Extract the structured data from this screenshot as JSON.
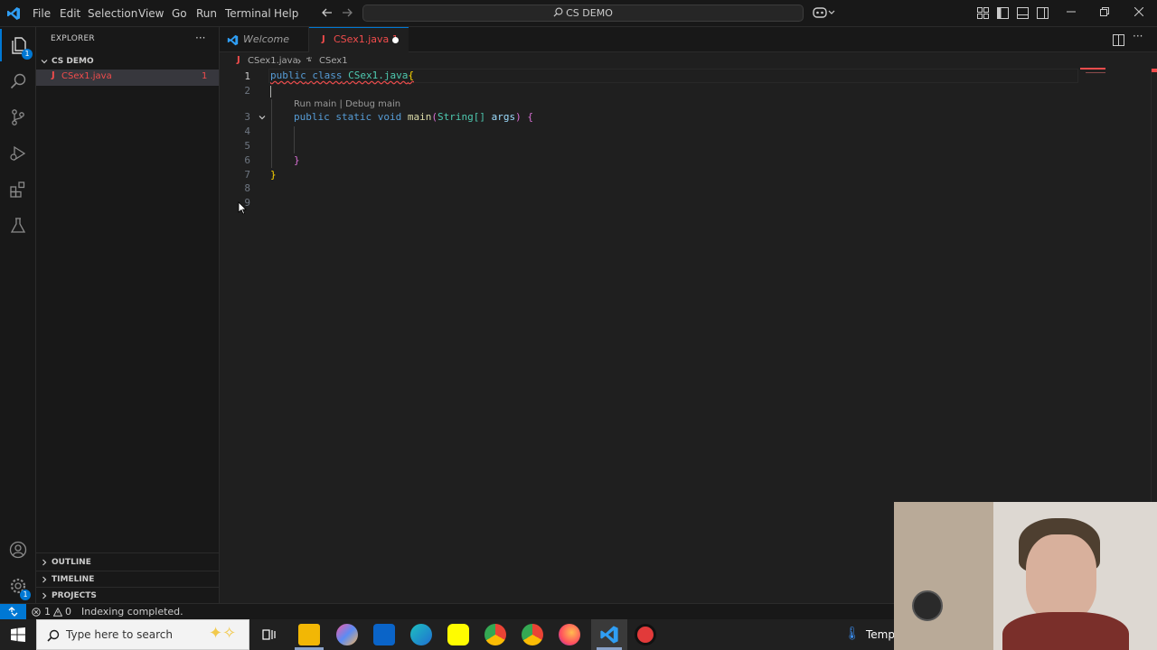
{
  "titlebar": {
    "menu": [
      "File",
      "Edit",
      "Selection",
      "View",
      "Go",
      "Run",
      "Terminal",
      "Help"
    ],
    "search_text": "CS DEMO"
  },
  "activity": {
    "icons": [
      "explorer-icon",
      "search-icon",
      "source-control-icon",
      "run-debug-icon",
      "extensions-icon",
      "testing-icon",
      "account-icon",
      "manage-gear-icon"
    ],
    "explorer_badge": "1",
    "manage_badge": "1"
  },
  "sidebar": {
    "title": "EXPLORER",
    "more": "···",
    "folder": "CS DEMO",
    "file": {
      "name": "CSex1.java",
      "problems": "1"
    },
    "sections": [
      "OUTLINE",
      "TIMELINE",
      "PROJECTS"
    ]
  },
  "tabs": [
    {
      "label": "Welcome"
    },
    {
      "label": "CSex1.java 1"
    }
  ],
  "breadcrumb": {
    "file": "CSex1.java",
    "symbol": "CSex1"
  },
  "editor": {
    "line_numbers": [
      "1",
      "2",
      "3",
      "4",
      "5",
      "6",
      "7",
      "8",
      "9"
    ],
    "codelens": "Run main | Debug main",
    "line1": {
      "kw1": "public",
      "kw2": "class",
      "name": "CSex1.java",
      "brace": "{"
    },
    "line3": {
      "kw1": "public",
      "kw2": "static",
      "kw3": "void",
      "fn": "main",
      "open": "(",
      "type": "String[]",
      "param": "args",
      "close": ")",
      "brace": "{"
    },
    "line6": "}",
    "line7": "}"
  },
  "status": {
    "errors": "1",
    "warnings": "0",
    "message": "Indexing completed."
  },
  "taskbar": {
    "search_placeholder": "Type here to search",
    "weather": "Temps"
  },
  "colors": {
    "accent": "#0078d4",
    "error": "#f14c4c",
    "editor_bg": "#1f1f1f",
    "chrome_bg": "#181818"
  }
}
